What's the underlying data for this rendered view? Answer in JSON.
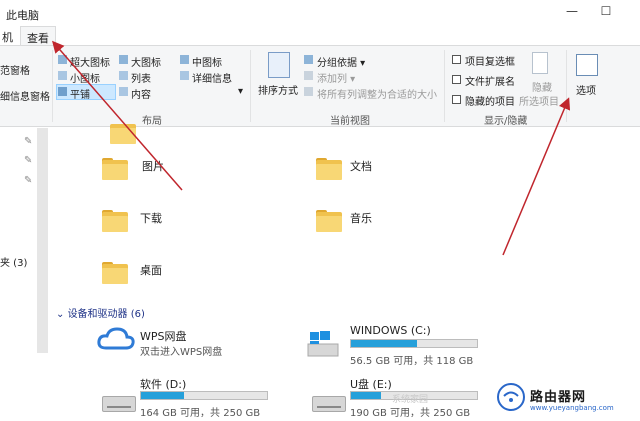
{
  "window": {
    "title": "此电脑",
    "minimize": "—",
    "maximize": "☐"
  },
  "tabs": [
    {
      "label": "机"
    },
    {
      "label": "查看"
    }
  ],
  "ribbon": {
    "nav_pane": {
      "items": [
        "范窗格",
        "细信息窗格"
      ]
    },
    "layout": {
      "title": "布局",
      "options": [
        "超大图标",
        "大图标",
        "中图标",
        "小图标",
        "列表",
        "详细信息",
        "平铺",
        "内容"
      ],
      "selected": "平铺",
      "more": "▾"
    },
    "current_view": {
      "title": "当前视图",
      "sort_label": "排序方式",
      "group_by": "分组依据 ▾",
      "add_column": "添加列 ▾",
      "fit_columns": "将所有列调整为合适的大小"
    },
    "show_hide": {
      "title": "显示/隐藏",
      "checkboxes": [
        "项目复选框",
        "文件扩展名",
        "隐藏的项目"
      ],
      "hide_label": "隐藏",
      "hide_sub": "所选项目"
    },
    "options": {
      "label": "选项"
    }
  },
  "left_pane": {
    "items": [
      "夹 (3)"
    ]
  },
  "folders": [
    {
      "label": "图片"
    },
    {
      "label": "文档"
    },
    {
      "label": "下载"
    },
    {
      "label": "音乐"
    },
    {
      "label": "桌面"
    }
  ],
  "devices": {
    "header": "设备和驱动器 (6)",
    "drives": [
      {
        "name": "WPS网盘",
        "info": "双击进入WPS网盘"
      },
      {
        "name": "WINDOWS (C:)",
        "info": "56.5 GB 可用，共 118 GB",
        "used": 0.52
      },
      {
        "name": "软件 (D:)",
        "info": "164 GB 可用，共 250 GB",
        "used": 0.34
      },
      {
        "name": "U盘 (E:)",
        "info": "190 GB 可用，共 250 GB",
        "used": 0.24
      }
    ]
  },
  "watermark": {
    "text": "系统家园",
    "logo_title": "路由器网",
    "logo_url": "www.yueyangbang.com"
  },
  "colors": {
    "accent": "#26a0da",
    "arrow": "#c0262d",
    "folder": "#f0c24e"
  }
}
